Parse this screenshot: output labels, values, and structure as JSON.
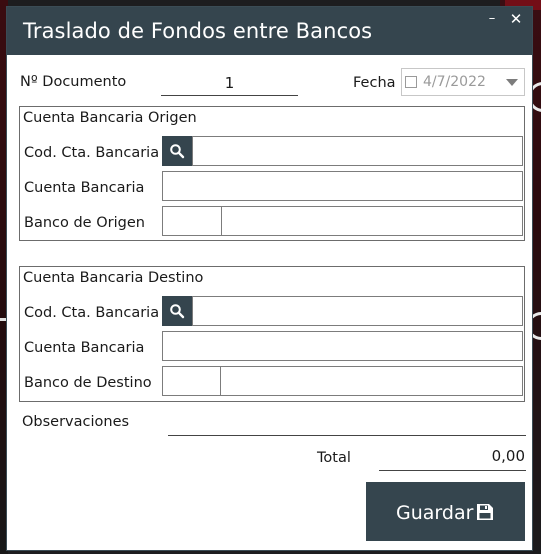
{
  "window": {
    "title": "Traslado de Fondos entre Bancos",
    "minimize_symbol": "–",
    "close_symbol": "✕"
  },
  "header": {
    "doc_label": "Nº Documento",
    "doc_value": "1",
    "date_label": "Fecha",
    "date_value": "4/7/2022",
    "date_checked": false
  },
  "origin": {
    "title": "Cuenta Bancaria Origen",
    "code_label": "Cod. Cta. Bancaria",
    "code_value": "",
    "account_label": "Cuenta Bancaria",
    "account_value": "",
    "bank_label": "Banco de Origen",
    "bank_code": "",
    "bank_name": ""
  },
  "destination": {
    "title": "Cuenta Bancaria Destino",
    "code_label": "Cod. Cta. Bancaria",
    "code_value": "",
    "account_label": "Cuenta Bancaria",
    "account_value": "",
    "bank_label": "Banco de Destino",
    "bank_code": "",
    "bank_name": ""
  },
  "observations": {
    "label": "Observaciones",
    "value": ""
  },
  "total": {
    "label": "Total",
    "value": "0,00"
  },
  "actions": {
    "save_label": "Guardar"
  },
  "icons": {
    "search": "search-icon",
    "save": "floppy-disk-icon",
    "minimize": "minimize-icon",
    "close": "close-icon"
  },
  "colors": {
    "titlebar": "#35454e",
    "button": "#35454e",
    "accent_bg_red": "#8c0f1a"
  }
}
